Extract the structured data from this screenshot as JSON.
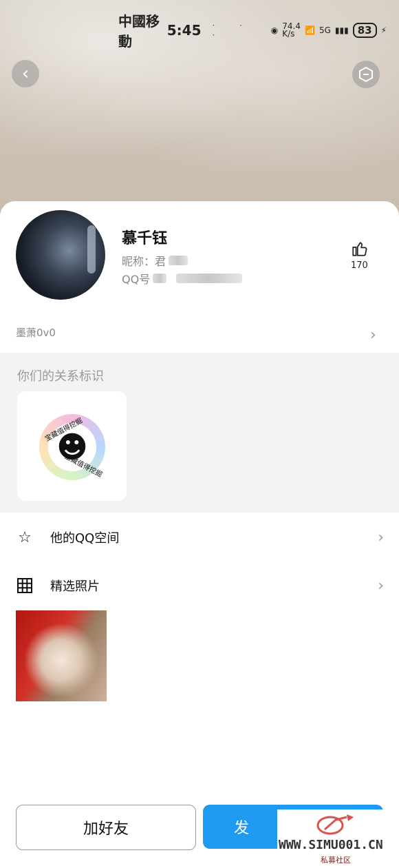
{
  "status_bar": {
    "carrier": "中國移動",
    "time": "5:45",
    "net_speed_value": "74.4",
    "net_speed_unit": "K/s",
    "net_type": "5G",
    "battery": "83"
  },
  "profile": {
    "name": "慕千钰",
    "nickname_label": "昵称：君",
    "qq_label": "QQ号",
    "likes": "170",
    "signature": "墨萧0v0"
  },
  "relation": {
    "title": "你们的关系标识",
    "badge_text_top": "宝藏值得挖掘",
    "badge_text_bottom": "宝藏值得挖掘"
  },
  "menu": {
    "qzone_label": "他的QQ空间",
    "photos_label": "精选照片"
  },
  "actions": {
    "add_friend": "加好友",
    "send_partial": "发"
  },
  "watermark": {
    "site": "WWW.SIMU001.CN",
    "sub": "私募社区"
  },
  "colors": {
    "primary": "#1e9bf0",
    "gray_bg": "#f3f3f3"
  }
}
